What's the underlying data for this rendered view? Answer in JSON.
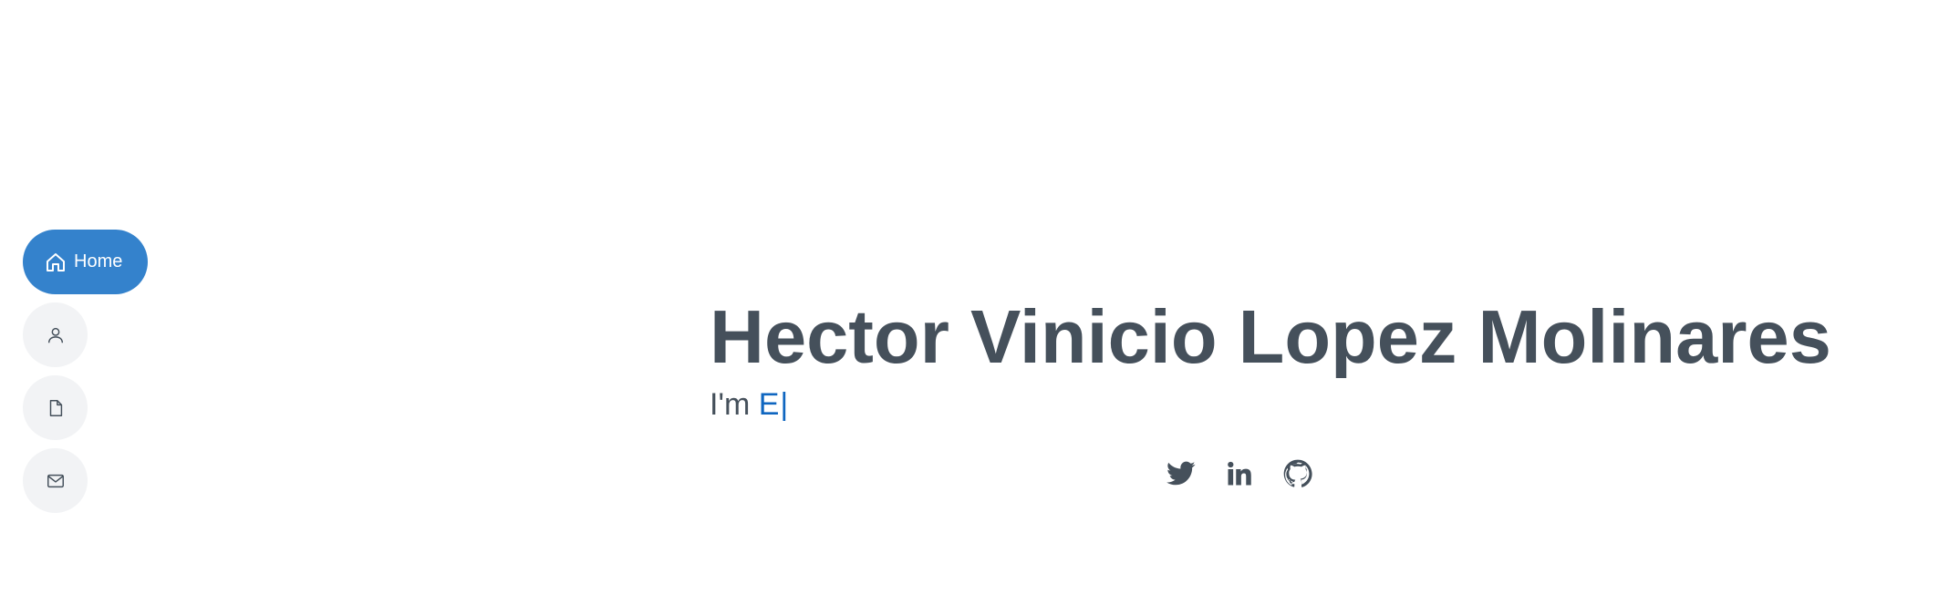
{
  "nav": {
    "items": [
      {
        "label": "Home",
        "icon": "home-icon",
        "active": true
      },
      {
        "label": "",
        "icon": "person-icon",
        "active": false
      },
      {
        "label": "",
        "icon": "file-icon",
        "active": false
      },
      {
        "label": "",
        "icon": "envelope-icon",
        "active": false
      }
    ]
  },
  "hero": {
    "name": "Hector Vinicio Lopez Molinares",
    "intro": "I'm",
    "typed_text": "E",
    "cursor": "|"
  },
  "socials": [
    {
      "icon": "twitter-icon"
    },
    {
      "icon": "linkedin-icon"
    },
    {
      "icon": "github-icon"
    }
  ],
  "colors": {
    "accent": "#3482cc",
    "text": "#45505b",
    "typed": "#0f66c0",
    "nav_bg": "#f2f3f5"
  }
}
